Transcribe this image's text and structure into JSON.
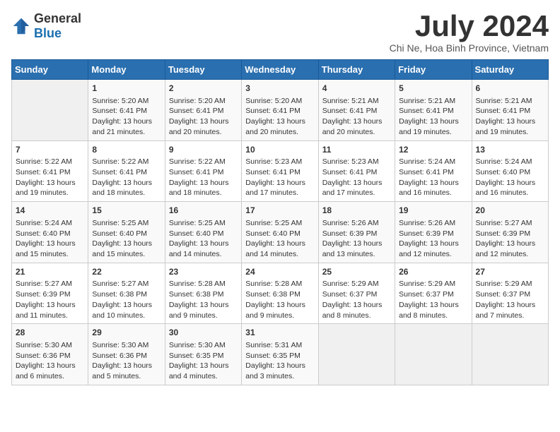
{
  "logo": {
    "text_general": "General",
    "text_blue": "Blue"
  },
  "title": "July 2024",
  "location": "Chi Ne, Hoa Binh Province, Vietnam",
  "days_of_week": [
    "Sunday",
    "Monday",
    "Tuesday",
    "Wednesday",
    "Thursday",
    "Friday",
    "Saturday"
  ],
  "weeks": [
    [
      {
        "day": "",
        "lines": []
      },
      {
        "day": "1",
        "lines": [
          "Sunrise: 5:20 AM",
          "Sunset: 6:41 PM",
          "Daylight: 13 hours",
          "and 21 minutes."
        ]
      },
      {
        "day": "2",
        "lines": [
          "Sunrise: 5:20 AM",
          "Sunset: 6:41 PM",
          "Daylight: 13 hours",
          "and 20 minutes."
        ]
      },
      {
        "day": "3",
        "lines": [
          "Sunrise: 5:20 AM",
          "Sunset: 6:41 PM",
          "Daylight: 13 hours",
          "and 20 minutes."
        ]
      },
      {
        "day": "4",
        "lines": [
          "Sunrise: 5:21 AM",
          "Sunset: 6:41 PM",
          "Daylight: 13 hours",
          "and 20 minutes."
        ]
      },
      {
        "day": "5",
        "lines": [
          "Sunrise: 5:21 AM",
          "Sunset: 6:41 PM",
          "Daylight: 13 hours",
          "and 19 minutes."
        ]
      },
      {
        "day": "6",
        "lines": [
          "Sunrise: 5:21 AM",
          "Sunset: 6:41 PM",
          "Daylight: 13 hours",
          "and 19 minutes."
        ]
      }
    ],
    [
      {
        "day": "7",
        "lines": [
          "Sunrise: 5:22 AM",
          "Sunset: 6:41 PM",
          "Daylight: 13 hours",
          "and 19 minutes."
        ]
      },
      {
        "day": "8",
        "lines": [
          "Sunrise: 5:22 AM",
          "Sunset: 6:41 PM",
          "Daylight: 13 hours",
          "and 18 minutes."
        ]
      },
      {
        "day": "9",
        "lines": [
          "Sunrise: 5:22 AM",
          "Sunset: 6:41 PM",
          "Daylight: 13 hours",
          "and 18 minutes."
        ]
      },
      {
        "day": "10",
        "lines": [
          "Sunrise: 5:23 AM",
          "Sunset: 6:41 PM",
          "Daylight: 13 hours",
          "and 17 minutes."
        ]
      },
      {
        "day": "11",
        "lines": [
          "Sunrise: 5:23 AM",
          "Sunset: 6:41 PM",
          "Daylight: 13 hours",
          "and 17 minutes."
        ]
      },
      {
        "day": "12",
        "lines": [
          "Sunrise: 5:24 AM",
          "Sunset: 6:41 PM",
          "Daylight: 13 hours",
          "and 16 minutes."
        ]
      },
      {
        "day": "13",
        "lines": [
          "Sunrise: 5:24 AM",
          "Sunset: 6:40 PM",
          "Daylight: 13 hours",
          "and 16 minutes."
        ]
      }
    ],
    [
      {
        "day": "14",
        "lines": [
          "Sunrise: 5:24 AM",
          "Sunset: 6:40 PM",
          "Daylight: 13 hours",
          "and 15 minutes."
        ]
      },
      {
        "day": "15",
        "lines": [
          "Sunrise: 5:25 AM",
          "Sunset: 6:40 PM",
          "Daylight: 13 hours",
          "and 15 minutes."
        ]
      },
      {
        "day": "16",
        "lines": [
          "Sunrise: 5:25 AM",
          "Sunset: 6:40 PM",
          "Daylight: 13 hours",
          "and 14 minutes."
        ]
      },
      {
        "day": "17",
        "lines": [
          "Sunrise: 5:25 AM",
          "Sunset: 6:40 PM",
          "Daylight: 13 hours",
          "and 14 minutes."
        ]
      },
      {
        "day": "18",
        "lines": [
          "Sunrise: 5:26 AM",
          "Sunset: 6:39 PM",
          "Daylight: 13 hours",
          "and 13 minutes."
        ]
      },
      {
        "day": "19",
        "lines": [
          "Sunrise: 5:26 AM",
          "Sunset: 6:39 PM",
          "Daylight: 13 hours",
          "and 12 minutes."
        ]
      },
      {
        "day": "20",
        "lines": [
          "Sunrise: 5:27 AM",
          "Sunset: 6:39 PM",
          "Daylight: 13 hours",
          "and 12 minutes."
        ]
      }
    ],
    [
      {
        "day": "21",
        "lines": [
          "Sunrise: 5:27 AM",
          "Sunset: 6:39 PM",
          "Daylight: 13 hours",
          "and 11 minutes."
        ]
      },
      {
        "day": "22",
        "lines": [
          "Sunrise: 5:27 AM",
          "Sunset: 6:38 PM",
          "Daylight: 13 hours",
          "and 10 minutes."
        ]
      },
      {
        "day": "23",
        "lines": [
          "Sunrise: 5:28 AM",
          "Sunset: 6:38 PM",
          "Daylight: 13 hours",
          "and 9 minutes."
        ]
      },
      {
        "day": "24",
        "lines": [
          "Sunrise: 5:28 AM",
          "Sunset: 6:38 PM",
          "Daylight: 13 hours",
          "and 9 minutes."
        ]
      },
      {
        "day": "25",
        "lines": [
          "Sunrise: 5:29 AM",
          "Sunset: 6:37 PM",
          "Daylight: 13 hours",
          "and 8 minutes."
        ]
      },
      {
        "day": "26",
        "lines": [
          "Sunrise: 5:29 AM",
          "Sunset: 6:37 PM",
          "Daylight: 13 hours",
          "and 8 minutes."
        ]
      },
      {
        "day": "27",
        "lines": [
          "Sunrise: 5:29 AM",
          "Sunset: 6:37 PM",
          "Daylight: 13 hours",
          "and 7 minutes."
        ]
      }
    ],
    [
      {
        "day": "28",
        "lines": [
          "Sunrise: 5:30 AM",
          "Sunset: 6:36 PM",
          "Daylight: 13 hours",
          "and 6 minutes."
        ]
      },
      {
        "day": "29",
        "lines": [
          "Sunrise: 5:30 AM",
          "Sunset: 6:36 PM",
          "Daylight: 13 hours",
          "and 5 minutes."
        ]
      },
      {
        "day": "30",
        "lines": [
          "Sunrise: 5:30 AM",
          "Sunset: 6:35 PM",
          "Daylight: 13 hours",
          "and 4 minutes."
        ]
      },
      {
        "day": "31",
        "lines": [
          "Sunrise: 5:31 AM",
          "Sunset: 6:35 PM",
          "Daylight: 13 hours",
          "and 3 minutes."
        ]
      },
      {
        "day": "",
        "lines": []
      },
      {
        "day": "",
        "lines": []
      },
      {
        "day": "",
        "lines": []
      }
    ]
  ]
}
